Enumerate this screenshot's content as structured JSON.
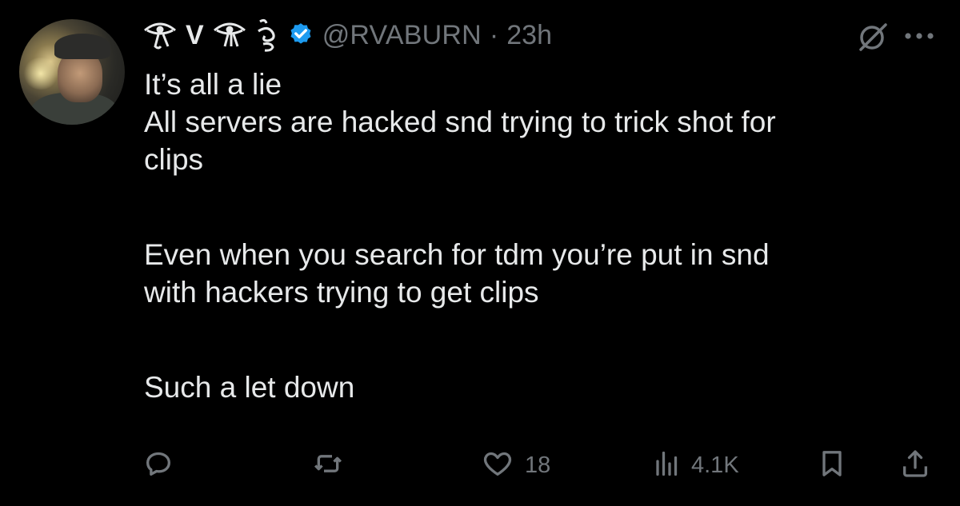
{
  "tweet": {
    "author": {
      "display_name_glyphs": [
        "eye-of-horus-glyph",
        "V",
        "eye-of-horus-glyph",
        "khmer-glyph"
      ],
      "display_letter": "V",
      "verified": true,
      "handle": "@RVABURN",
      "separator": "·",
      "time": "23h",
      "avatar": "user-avatar-photo"
    },
    "paragraphs": [
      [
        "It’s all a lie",
        "All servers are hacked snd trying to trick shot for",
        "clips"
      ],
      [
        "Even when you search for tdm you’re put in snd",
        "with hackers trying to get clips"
      ],
      [
        "Such a let down"
      ]
    ],
    "actions": {
      "reply": {
        "icon": "reply-icon",
        "count": ""
      },
      "repost": {
        "icon": "repost-icon",
        "count": ""
      },
      "like": {
        "icon": "heart-icon",
        "count": "18"
      },
      "views": {
        "icon": "views-chart-icon",
        "count": "4.1K"
      },
      "bookmark": {
        "icon": "bookmark-icon"
      },
      "share": {
        "icon": "share-icon"
      }
    },
    "top_right": {
      "grok": "grok-icon",
      "more": "more-icon"
    }
  },
  "colors": {
    "background": "#000000",
    "text_primary": "#e7e9ea",
    "text_secondary": "#71767b",
    "verified_blue": "#1d9bf0"
  }
}
